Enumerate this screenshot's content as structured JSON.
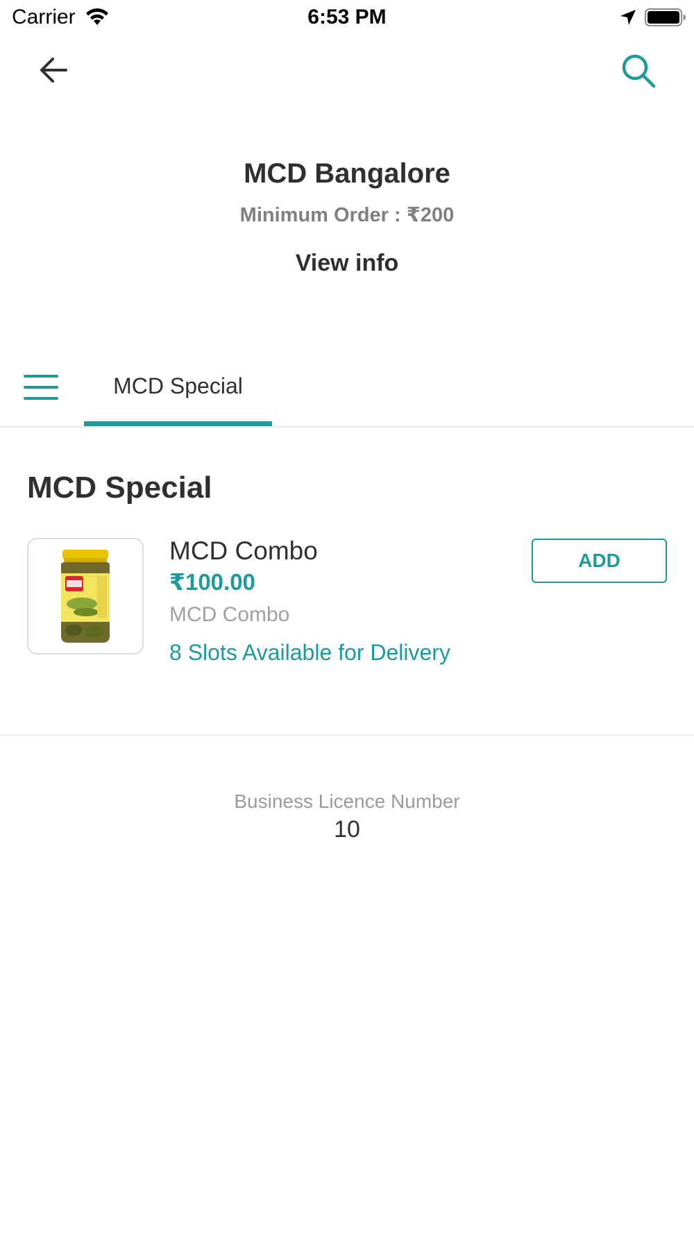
{
  "status_bar": {
    "carrier": "Carrier",
    "time": "6:53 PM",
    "icons": [
      "wifi-icon",
      "location-arrow-icon",
      "battery-icon"
    ]
  },
  "nav": {
    "back_icon": "arrow-left-icon",
    "search_icon": "search-icon"
  },
  "store": {
    "name": "MCD Bangalore",
    "minimum_order": "Minimum Order : ₹200",
    "view_info": "View info"
  },
  "tabs": {
    "menu_icon": "hamburger-menu-icon",
    "items": [
      {
        "label": "MCD Special",
        "active": true
      }
    ]
  },
  "section": {
    "title": "MCD Special",
    "products": [
      {
        "name": "MCD Combo",
        "price": "₹100.00",
        "description": "MCD Combo",
        "slots": "8 Slots Available for Delivery",
        "add_label": "ADD"
      }
    ]
  },
  "licence": {
    "label": "Business Licence Number",
    "value": "10"
  },
  "colors": {
    "accent": "#1d9a9a",
    "text": "#2f2f2f",
    "muted": "#a0a0a0",
    "divider": "#ececec"
  }
}
